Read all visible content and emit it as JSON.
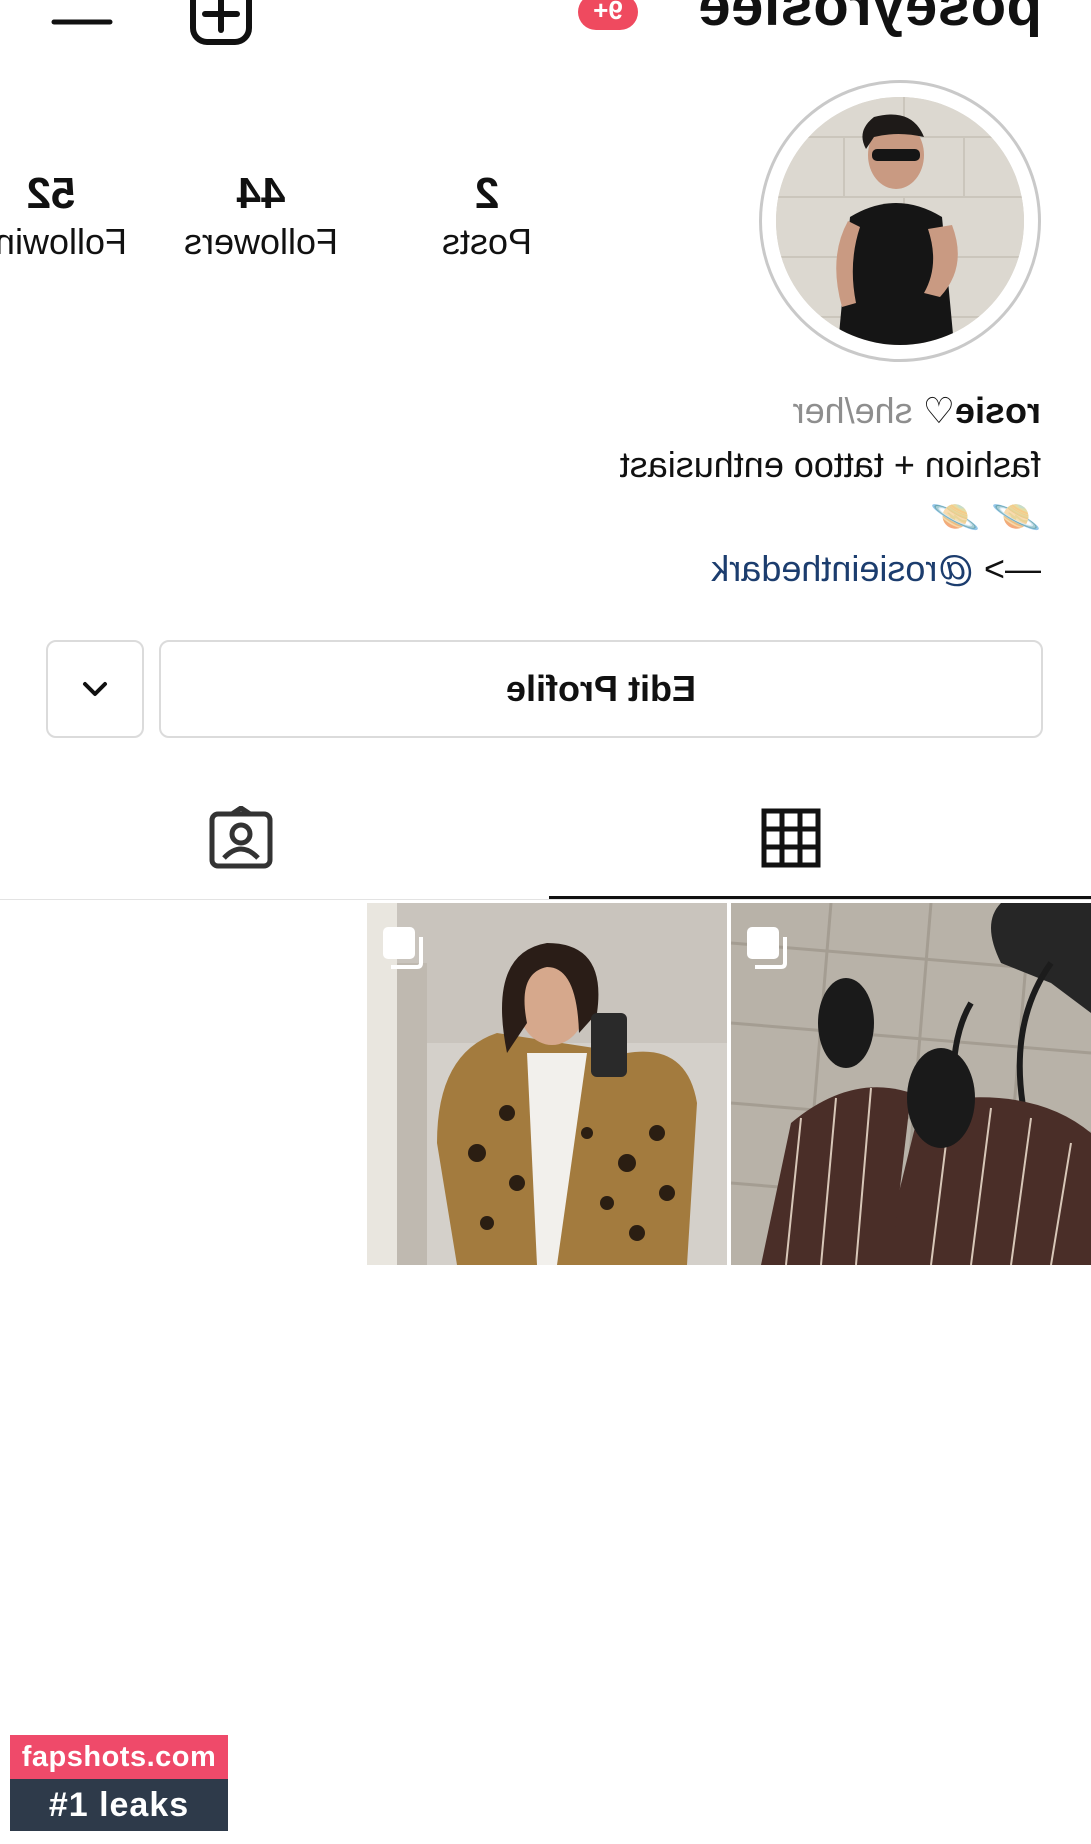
{
  "header": {
    "username": "poseyrosiee",
    "notification_badge": "9+"
  },
  "profile": {
    "stats": [
      {
        "count": "2",
        "label": "Posts"
      },
      {
        "count": "44",
        "label": "Followers"
      },
      {
        "count": "52",
        "label": "Following"
      }
    ],
    "bio": {
      "name": "rosie",
      "heart": "♡",
      "pronouns": "she/her",
      "line1": "fashion + tattoo enthusiast",
      "emoji": "🪐 🪐",
      "arrow": "—>",
      "link": "@rosieinthedark"
    }
  },
  "actions": {
    "edit_profile_label": "Edit Profile",
    "dropdown_icon": "chevron-down-icon"
  },
  "tabs": [
    {
      "icon": "grid-icon",
      "active": true
    },
    {
      "icon": "tagged-icon",
      "active": false
    }
  ],
  "watermark": {
    "line1": "fapshots.com",
    "line2": "#1 leaks"
  },
  "colors": {
    "badge": "#ef4a5f",
    "link": "#1c3d6e",
    "border": "#dbdbdb",
    "watermark_top": "#ef4a6a",
    "watermark_bottom": "#2e3a4a"
  }
}
